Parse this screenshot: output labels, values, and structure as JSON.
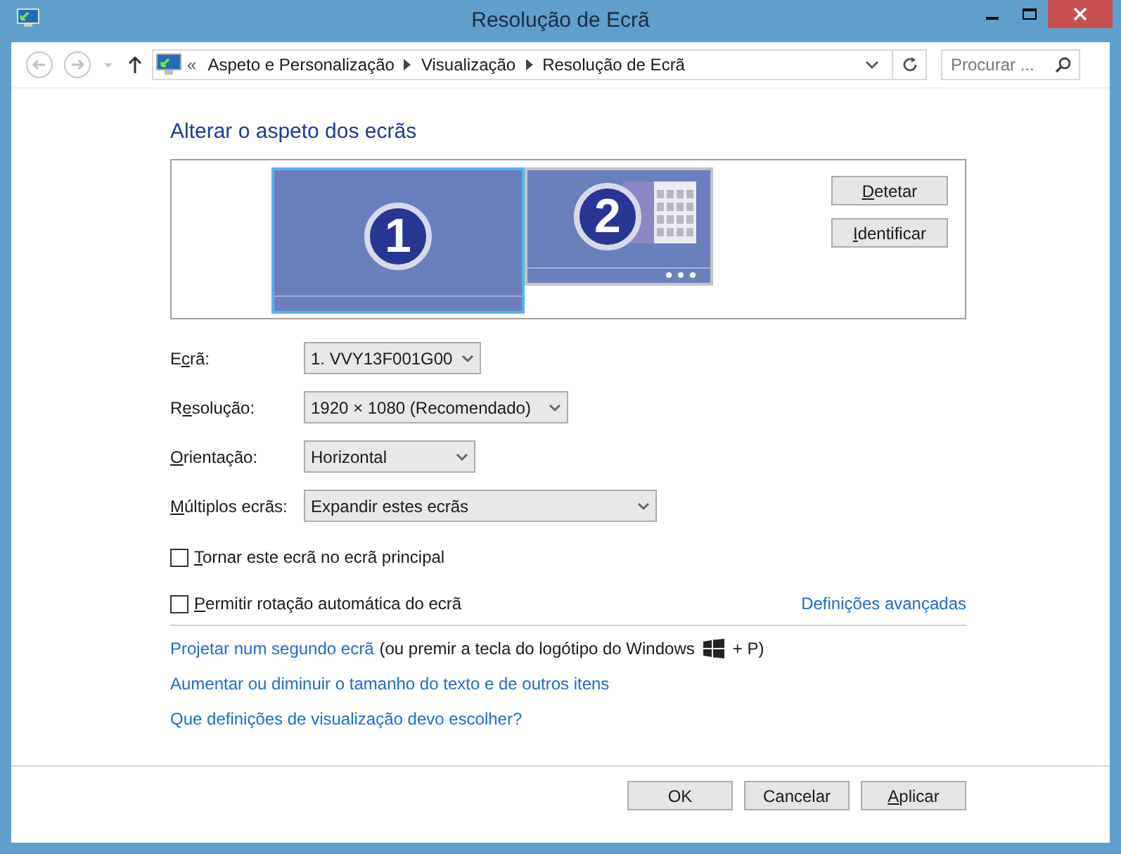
{
  "window": {
    "title": "Resolução de Ecrã"
  },
  "address_bar": {
    "breadcrumbs": [
      "Aspeto e Personalização",
      "Visualização",
      "Resolução de Ecrã"
    ],
    "overflow": "«"
  },
  "search": {
    "placeholder": "Procurar ..."
  },
  "heading": "Alterar o aspeto dos ecrãs",
  "displays": [
    {
      "number": "1",
      "selected": true
    },
    {
      "number": "2",
      "selected": false
    }
  ],
  "preview_buttons": [
    {
      "key": "D",
      "after": "etetar"
    },
    {
      "key": "I",
      "after": "dentificar"
    }
  ],
  "settings": [
    {
      "before": "E",
      "key": "c",
      "after": "rã:",
      "value": "1. VVY13F001G00",
      "kind": "short"
    },
    {
      "before": "R",
      "key": "e",
      "after": "solução:",
      "value": "1920 × 1080 (Recomendado)",
      "kind": "medium"
    },
    {
      "key": "O",
      "after": "rientação:",
      "value": "Horizontal",
      "kind": "short"
    },
    {
      "key": "M",
      "after": "últiplos ecrãs:",
      "value": "Expandir estes ecrãs",
      "kind": "long"
    }
  ],
  "checkboxes": [
    {
      "key": "T",
      "after": "ornar este ecrã no ecrã principal",
      "checked": false
    },
    {
      "key": "P",
      "after": "ermitir rotação automática do ecrã",
      "checked": false
    }
  ],
  "advanced_link": "Definições avançadas",
  "project_line": {
    "link": "Projetar num segundo ecrã",
    "text": "(ou premir a tecla do logótipo do Windows",
    "suffix": "+ P)"
  },
  "links": [
    "Aumentar ou diminuir o tamanho do texto e de outros itens",
    "Que definições de visualização devo escolher?"
  ],
  "buttons": [
    {
      "after": "OK"
    },
    {
      "after": "Cancelar"
    },
    {
      "key": "A",
      "after": "plicar"
    }
  ]
}
